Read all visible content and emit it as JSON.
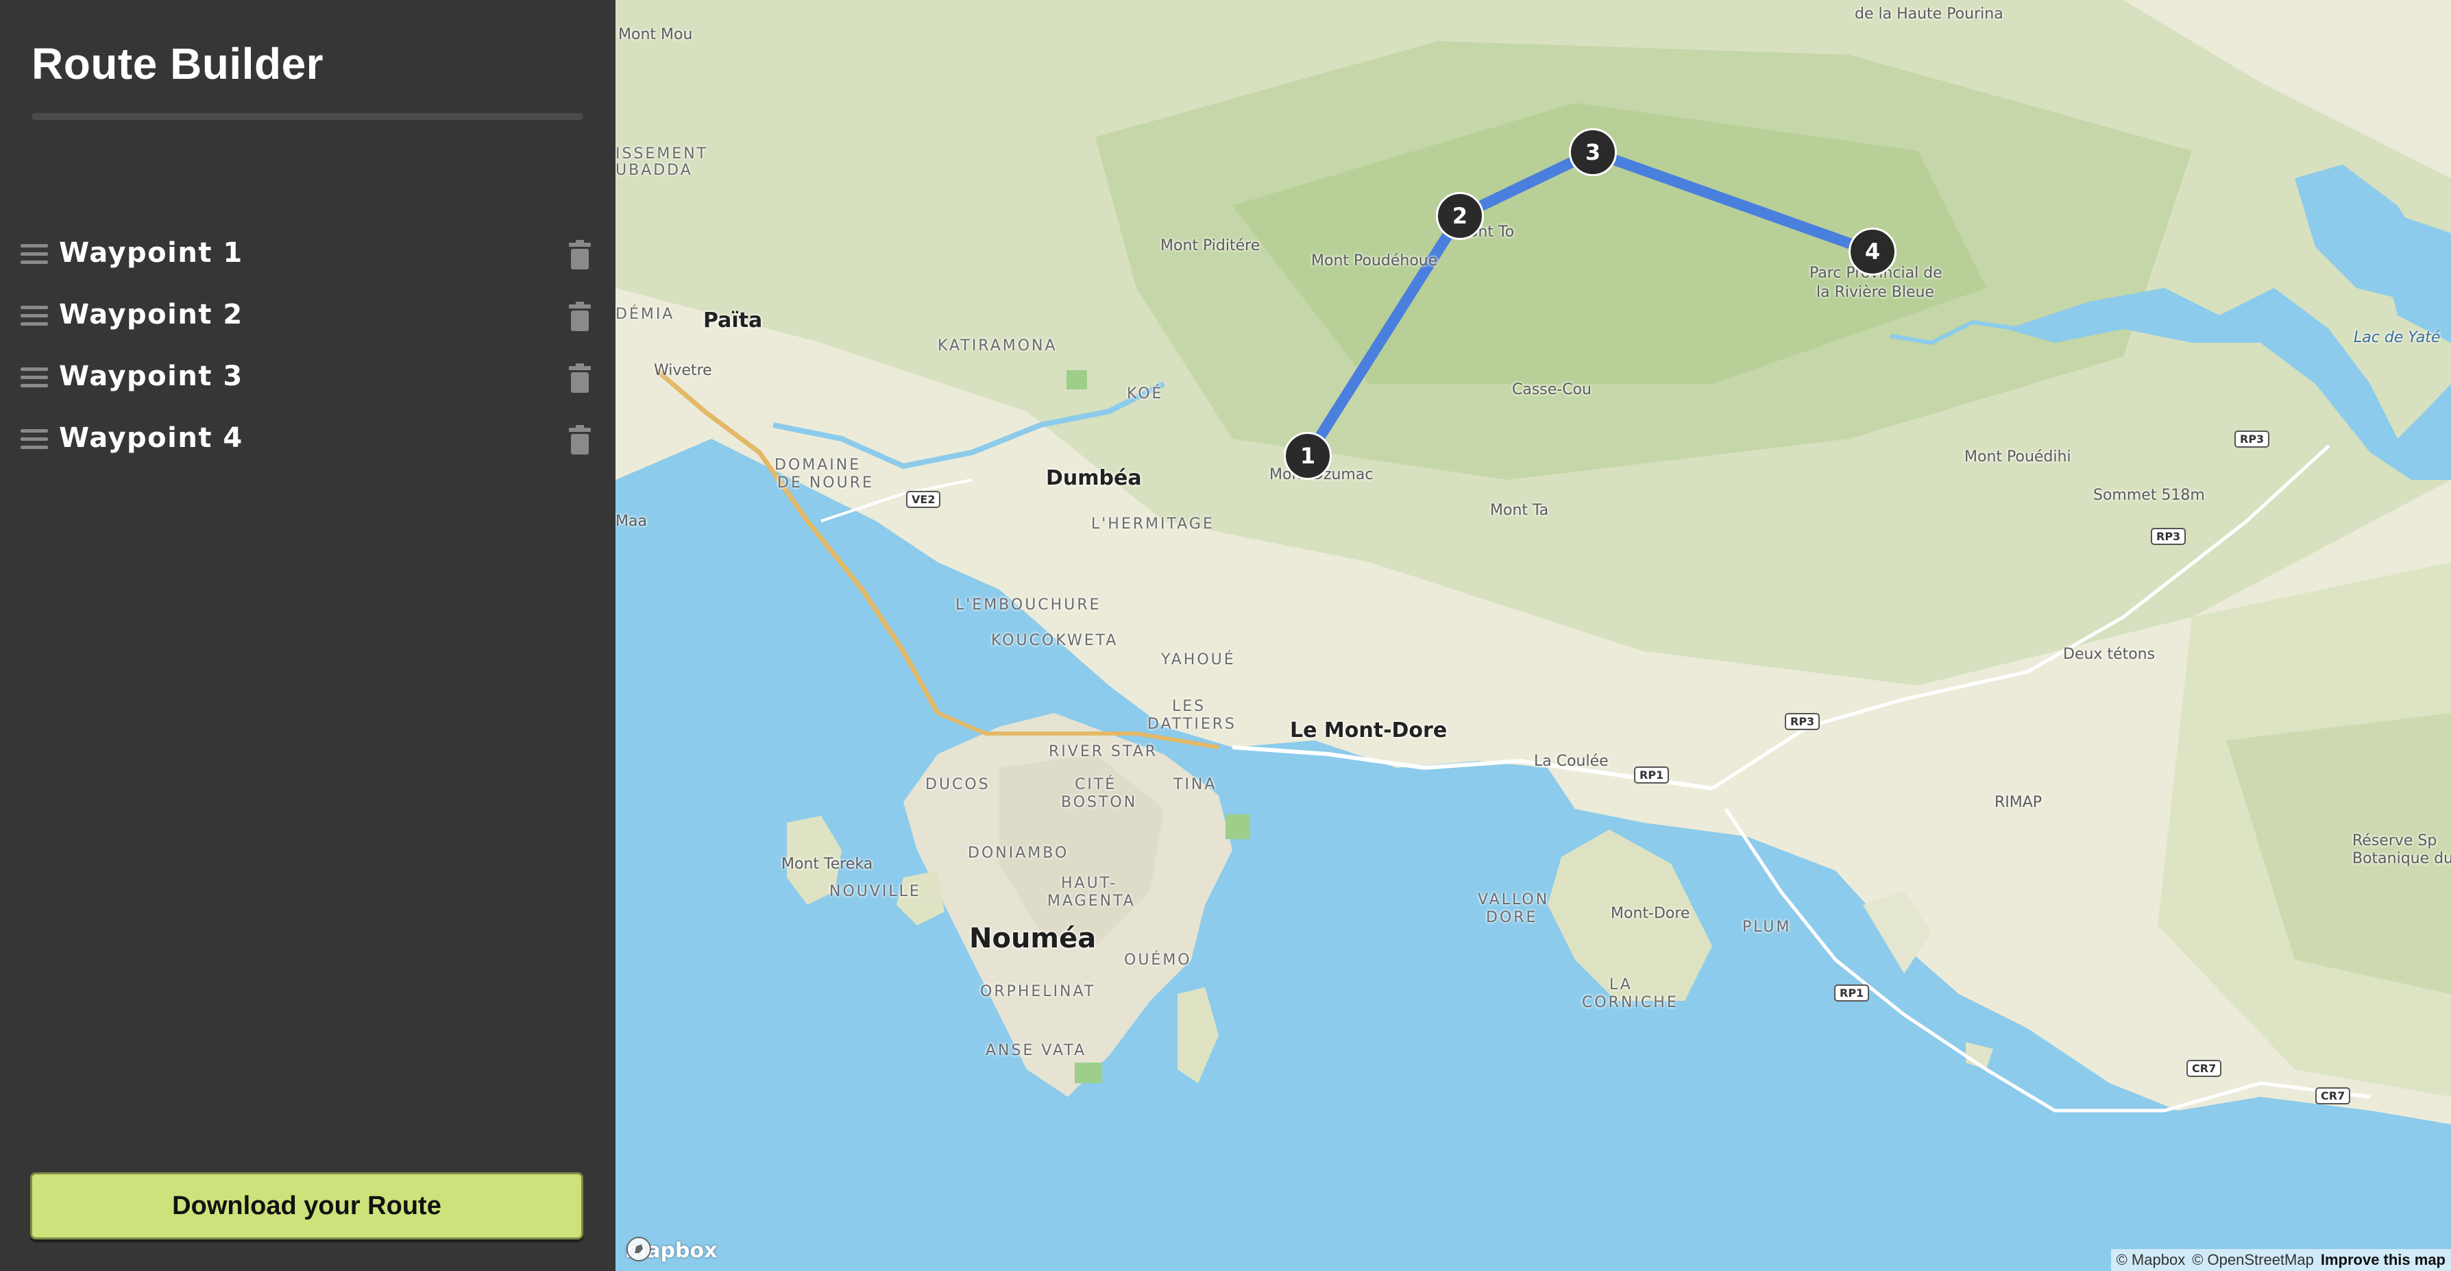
{
  "sidebar": {
    "title": "Route Builder",
    "waypoints": [
      {
        "label": "Waypoint  1"
      },
      {
        "label": "Waypoint  2"
      },
      {
        "label": "Waypoint  3"
      },
      {
        "label": "Waypoint  4"
      }
    ],
    "download_label": "Download your Route"
  },
  "map": {
    "route_color": "#4a7fde",
    "markers": [
      "1",
      "2",
      "3",
      "4"
    ],
    "labels": {
      "mont_mou": "Mont Mou",
      "haute_pourina": "de la Haute Pourina",
      "issement": "ISSEMENT",
      "ubadda": "UBADDA",
      "mont_piditere": "Mont Piditére",
      "mont_poudehoue": "Mont Poudéhoue",
      "mont_to": "Mont To",
      "parc": "Parc Provincial de",
      "parc2": "la Rivière Bleue",
      "demia": "DÉMIA",
      "paita": "Païta",
      "katiramona": "KATIRAMONA",
      "wivetre": "Wivetre",
      "koe": "KOÉ",
      "casse_cou": "Casse-Cou",
      "lac_yate": "Lac de Yaté",
      "domaine": "DOMAINE",
      "de_noure": "DE NOURE",
      "dumbea": "Dumbéa",
      "mont_dzumac": "Mont Dzumac",
      "mont_pouedihi": "Mont Pouédihi",
      "sommet": "Sommet 518m",
      "l_hermitage": "L'HERMITAGE",
      "mont_ta": "Mont Ta",
      "maa": "Maa",
      "l_embouchure": "L'EMBOUCHURE",
      "koucokweta": "KOUCOKWETA",
      "yahoue": "YAHOUÉ",
      "deux_tetons": "Deux tétons",
      "les": "LES",
      "dattiers": "DATTIERS",
      "le_mont_dore": "Le Mont-Dore",
      "river_star": "RIVER STAR",
      "la_coulee": "La Coulée",
      "ducos": "DUCOS",
      "cite": "CITÉ",
      "boston": "BOSTON",
      "tina": "TINA",
      "rimap": "RIMAP",
      "reserve": "Réserve Sp",
      "botanique": "Botanique du",
      "mont_tereka": "Mont Tereka",
      "doniambo": "DONIAMBO",
      "nouville": "NOUVILLE",
      "haut": "HAUT-",
      "magenta": "MAGENTA",
      "vallon": "VALLON",
      "dore": "DORE",
      "mont_dore": "Mont-Dore",
      "noumea": "Nouméa",
      "ouemo": "OUÉMO",
      "plum": "PLUM",
      "orphelinat": "ORPHELINAT",
      "la": "LA",
      "corniche": "CORNICHE",
      "anse_vata": "ANSE VATA"
    },
    "shields": {
      "ve2": "VE2",
      "rp3a": "RP3",
      "rp3b": "RP3",
      "rp3c": "RP3",
      "rp1a": "RP1",
      "rp1b": "RP1",
      "cr7a": "CR7",
      "cr7b": "CR7"
    },
    "logo": "mapbox",
    "attribution": {
      "mapbox": "© Mapbox",
      "osm": "© OpenStreetMap",
      "improve": "Improve this map"
    }
  }
}
